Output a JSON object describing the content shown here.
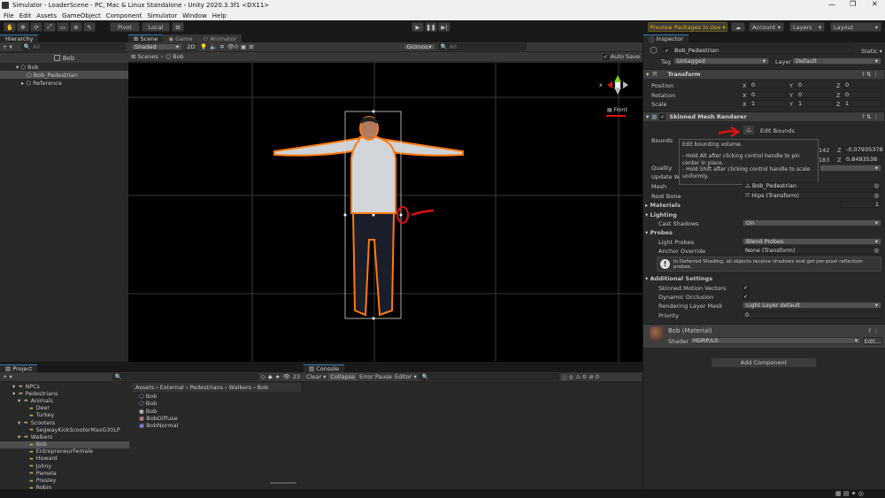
{
  "window": {
    "title": "Simulator - LoaderScene - PC, Mac & Linux Standalone - Unity 2020.3.3f1 <DX11>"
  },
  "menu": [
    "File",
    "Edit",
    "Assets",
    "GameObject",
    "Component",
    "Simulator",
    "Window",
    "Help"
  ],
  "toolbar": {
    "pivot_label": "Pivot",
    "local_label": "Local",
    "preview_packages": "Preview Packages in Use",
    "account": "Account",
    "layers": "Layers",
    "layout": "Layout"
  },
  "hierarchy": {
    "tab": "Hierarchy",
    "search_placeholder": "All",
    "scene_name": "Bob",
    "items": [
      {
        "label": "Bob",
        "depth": 0,
        "selected": false
      },
      {
        "label": "Bob_Pedestrian",
        "depth": 1,
        "selected": true
      },
      {
        "label": "Reference",
        "depth": 1,
        "selected": false
      }
    ]
  },
  "scene": {
    "tabs": [
      "Scene",
      "Game",
      "Animator"
    ],
    "shading": "Shaded",
    "mode_2d": "2D",
    "gizmos": "Gizmos",
    "search_placeholder": "All",
    "breadcrumb_root": "Scenes",
    "breadcrumb_item": "Bob",
    "auto_save": "Auto Save",
    "view_label": "Front",
    "axis_x": "x"
  },
  "tooltip": {
    "line1": "Edit bounding volume.",
    "line2": "- Hold Alt after clicking control handle to pin center in place.",
    "line3": "- Hold Shift after clicking control handle to scale uniformly."
  },
  "inspector": {
    "tab": "Inspector",
    "object_name": "Bob_Pedestrian",
    "static": "Static",
    "tag_label": "Tag",
    "tag_value": "Untagged",
    "layer_label": "Layer",
    "layer_value": "Default",
    "transform": {
      "title": "Transform",
      "rows": [
        {
          "label": "Position",
          "x": "0",
          "y": "0",
          "z": "0"
        },
        {
          "label": "Rotation",
          "x": "0",
          "y": "0",
          "z": "0"
        },
        {
          "label": "Scale",
          "x": "1",
          "y": "1",
          "z": "1"
        }
      ]
    },
    "smr": {
      "title": "Skinned Mesh Renderer",
      "edit_bounds": "Edit Bounds",
      "bounds_label": "Bounds",
      "bounds_rows": [
        {
          "partial": "142",
          "z": "-0.07935378"
        },
        {
          "partial": "183",
          "z": "0.8493538"
        }
      ],
      "quality_label": "Quality",
      "update_label": "Update Wh",
      "mesh_label": "Mesh",
      "mesh_value": "Bob_Pedestrian",
      "rootbone_label": "Root Bone",
      "rootbone_value": "Hips (Transform)",
      "materials_label": "Materials",
      "materials_count": "1",
      "lighting_label": "Lighting",
      "cast_shadows_label": "Cast Shadows",
      "cast_shadows_value": "On",
      "probes_label": "Probes",
      "light_probes_label": "Light Probes",
      "light_probes_value": "Blend Probes",
      "anchor_label": "Anchor Override",
      "anchor_value": "None (Transform)",
      "info_text": "In Deferred Shading, all objects receive shadows and get per-pixel reflection probes.",
      "additional_label": "Additional Settings",
      "motion_label": "Skinned Motion Vectors",
      "occlusion_label": "Dynamic Occlusion",
      "rlm_label": "Rendering Layer Mask",
      "rlm_value": "Light Layer default",
      "priority_label": "Priority",
      "priority_value": "0"
    },
    "material": {
      "name": "Bob (Material)",
      "shader_label": "Shader",
      "shader_value": "HDRP/Lit",
      "edit": "Edit..."
    },
    "add_component": "Add Component"
  },
  "project": {
    "tab": "Project",
    "count": "23",
    "tree": [
      {
        "label": "NPCs",
        "depth": 1
      },
      {
        "label": "Pedestrians",
        "depth": 1
      },
      {
        "label": "Animals",
        "depth": 2
      },
      {
        "label": "Deer",
        "depth": 3
      },
      {
        "label": "Turkey",
        "depth": 3
      },
      {
        "label": "Scooters",
        "depth": 2
      },
      {
        "label": "SegwayKickScooterMaxG30LP",
        "depth": 3
      },
      {
        "label": "Walkers",
        "depth": 2
      },
      {
        "label": "Bob",
        "depth": 3
      },
      {
        "label": "EntrepreneurFemale",
        "depth": 3
      },
      {
        "label": "Howard",
        "depth": 3
      },
      {
        "label": "Johny",
        "depth": 3
      },
      {
        "label": "Pamela",
        "depth": 3
      },
      {
        "label": "Presley",
        "depth": 3
      },
      {
        "label": "Robin",
        "depth": 3
      }
    ],
    "breadcrumb": [
      "Assets",
      "External",
      "Pedestrians",
      "Walkers",
      "Bob"
    ],
    "files": [
      "Bob",
      "Bob",
      "Bob",
      "BobDiffuse",
      "BobNormal"
    ]
  },
  "console": {
    "tab": "Console",
    "clear": "Clear",
    "collapse": "Collapse",
    "error_pause": "Error Pause",
    "editor": "Editor",
    "counts": [
      "0",
      "0",
      "0"
    ]
  }
}
